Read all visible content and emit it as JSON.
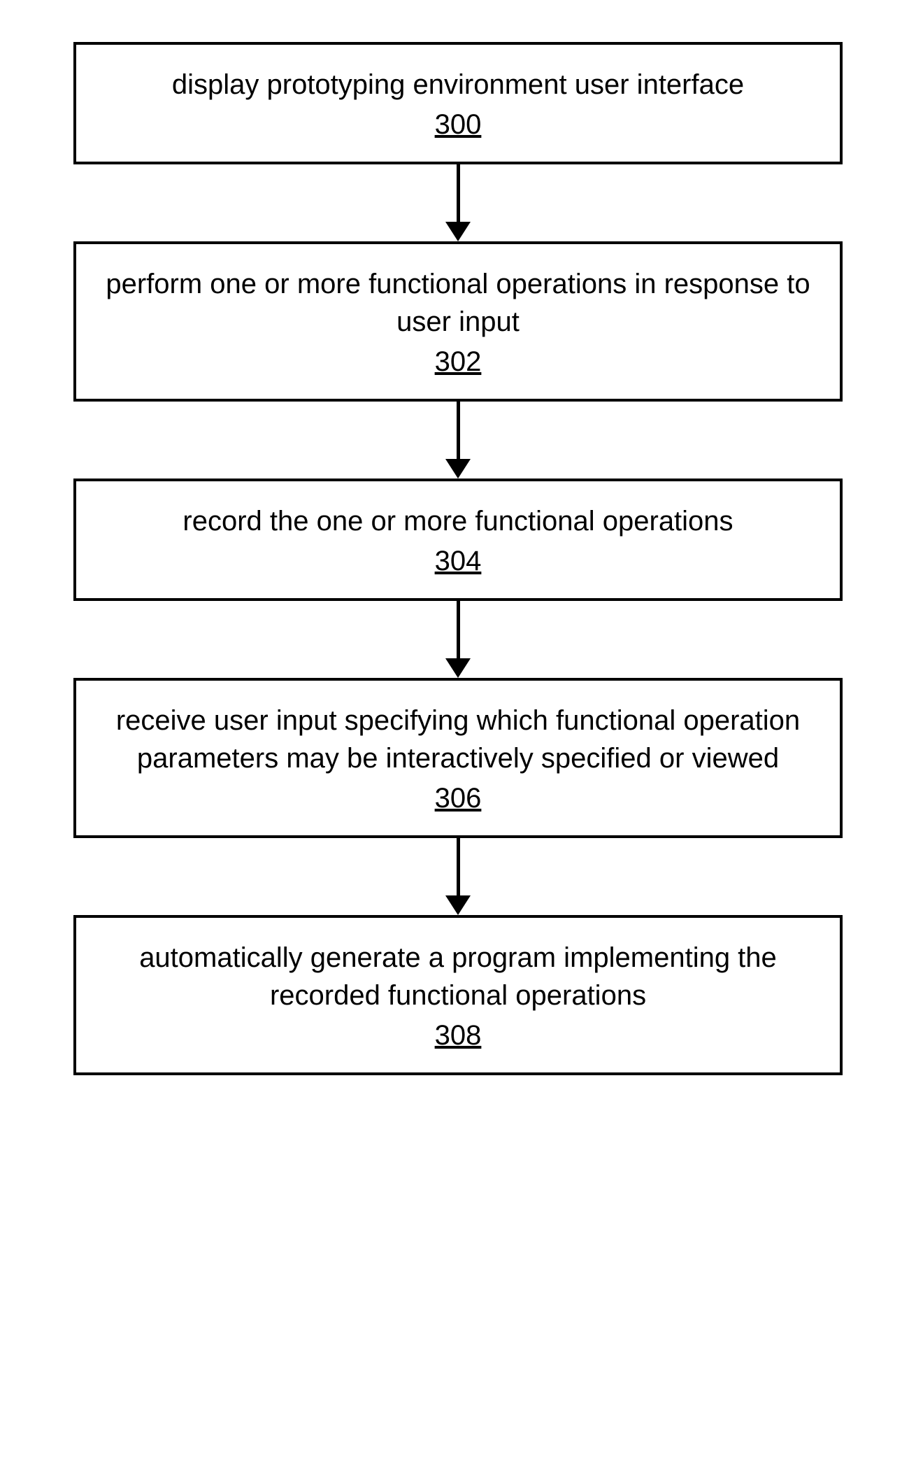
{
  "flowchart": {
    "steps": [
      {
        "text": "display prototyping environment user interface",
        "number": "300"
      },
      {
        "text": "perform one or more functional operations in response to user input",
        "number": "302"
      },
      {
        "text": "record the one or more functional operations",
        "number": "304"
      },
      {
        "text": "receive user input specifying which functional operation parameters may be interactively specified or viewed",
        "number": "306"
      },
      {
        "text": "automatically generate a program implementing the recorded functional operations",
        "number": "308"
      }
    ]
  }
}
